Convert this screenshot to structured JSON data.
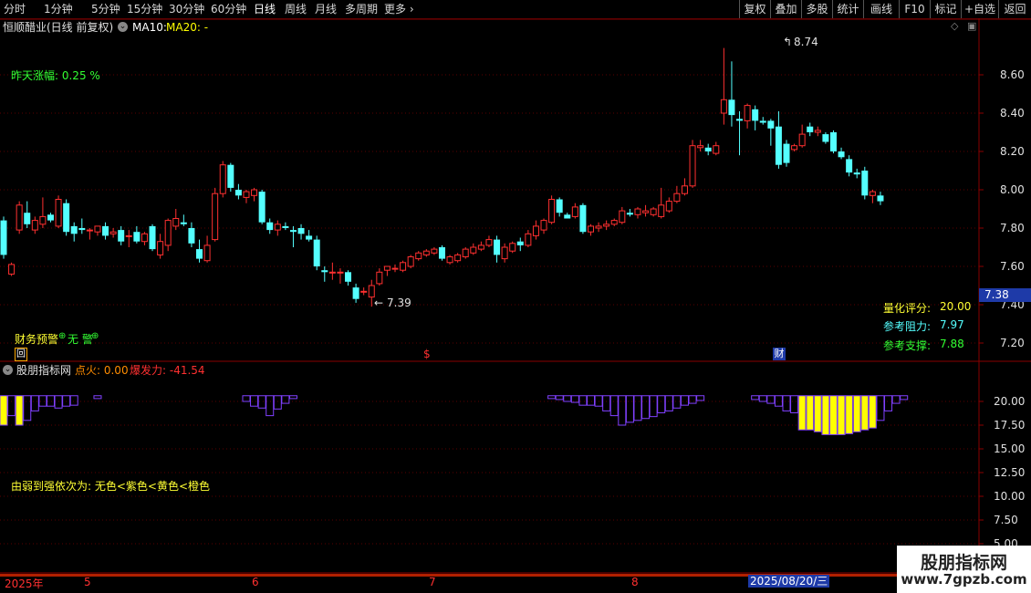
{
  "toolbar": {
    "periods": [
      "分时",
      "1分钟",
      "5分钟",
      "15分钟",
      "30分钟",
      "60分钟",
      "日线",
      "周线",
      "月线",
      "多周期",
      "更多"
    ],
    "active_period": "日线",
    "more_arrow": "›",
    "right_buttons": [
      "复权",
      "叠加",
      "多股",
      "统计",
      "画线",
      "F10",
      "标记",
      "+自选",
      "返回"
    ]
  },
  "main": {
    "stock_title": "恒顺醋业(日线 前复权)",
    "ma10_label": "MA10:",
    "ma20_label": "MA20: -",
    "yesterday_change": "昨天涨幅: 0.25 %",
    "high_label": "8.74",
    "low_label": "7.39",
    "current_price": "7.38",
    "score_label": "量化评分:",
    "score_value": "20.00",
    "resistance_label": "参考阻力:",
    "resistance_value": "7.97",
    "support_label": "参考支撑:",
    "support_value": "7.88",
    "warning_text": "财务预警",
    "no_warning_text": "无 警",
    "marker_hui": "回",
    "marker_dollar": "$",
    "marker_cai": "财",
    "price_axis": [
      "8.60",
      "8.40",
      "8.20",
      "8.00",
      "7.80",
      "7.60",
      "7.40",
      "7.20"
    ]
  },
  "sub": {
    "indicator_name": "股朋指标网",
    "ignite_label": "点火: 0.00",
    "burst_label": "爆发力: -41.54",
    "legend_text": "由弱到强依次为: 无色<紫色<黄色<橙色",
    "axis": [
      "20.00",
      "17.50",
      "15.00",
      "12.50",
      "10.00",
      "7.50",
      "5.00"
    ]
  },
  "timeline": {
    "labels": [
      "2025年",
      "5",
      "6",
      "7",
      "8"
    ],
    "date_box": "2025/08/20/三"
  },
  "watermark": {
    "line1": "股朋指标网",
    "line2": "www.7gpzb.com"
  },
  "colors": {
    "up": "#ff3030",
    "down": "#54ffff",
    "purple": "#8040ff",
    "yellow": "#ffff00",
    "grid": "#5a0000"
  },
  "chart_data": {
    "type": "candlestick",
    "price_ylim": [
      7.1,
      8.8
    ],
    "sub_ylim": [
      2.5,
      22.5
    ],
    "candles": [
      {
        "o": 7.84,
        "h": 7.86,
        "l": 7.64,
        "c": 7.66
      },
      {
        "o": 7.56,
        "h": 7.62,
        "l": 7.55,
        "c": 7.61
      },
      {
        "o": 7.79,
        "h": 7.94,
        "l": 7.77,
        "c": 7.92
      },
      {
        "o": 7.88,
        "h": 7.94,
        "l": 7.8,
        "c": 7.82
      },
      {
        "o": 7.79,
        "h": 7.86,
        "l": 7.77,
        "c": 7.84
      },
      {
        "o": 7.82,
        "h": 7.96,
        "l": 7.8,
        "c": 7.86
      },
      {
        "o": 7.87,
        "h": 7.88,
        "l": 7.83,
        "c": 7.84
      },
      {
        "o": 7.81,
        "h": 7.97,
        "l": 7.8,
        "c": 7.95
      },
      {
        "o": 7.93,
        "h": 7.95,
        "l": 7.76,
        "c": 7.78
      },
      {
        "o": 7.81,
        "h": 7.83,
        "l": 7.73,
        "c": 7.77
      },
      {
        "o": 7.8,
        "h": 7.85,
        "l": 7.77,
        "c": 7.79
      },
      {
        "o": 7.79,
        "h": 7.8,
        "l": 7.74,
        "c": 7.79
      },
      {
        "o": 7.78,
        "h": 7.81,
        "l": 7.76,
        "c": 7.81
      },
      {
        "o": 7.81,
        "h": 7.83,
        "l": 7.74,
        "c": 7.76
      },
      {
        "o": 7.77,
        "h": 7.8,
        "l": 7.75,
        "c": 7.78
      },
      {
        "o": 7.79,
        "h": 7.81,
        "l": 7.71,
        "c": 7.73
      },
      {
        "o": 7.76,
        "h": 7.79,
        "l": 7.7,
        "c": 7.76
      },
      {
        "o": 7.78,
        "h": 7.81,
        "l": 7.72,
        "c": 7.73
      },
      {
        "o": 7.73,
        "h": 7.78,
        "l": 7.71,
        "c": 7.77
      },
      {
        "o": 7.81,
        "h": 7.82,
        "l": 7.68,
        "c": 7.69
      },
      {
        "o": 7.66,
        "h": 7.77,
        "l": 7.64,
        "c": 7.73
      },
      {
        "o": 7.71,
        "h": 7.85,
        "l": 7.68,
        "c": 7.84
      },
      {
        "o": 7.81,
        "h": 7.9,
        "l": 7.79,
        "c": 7.85
      },
      {
        "o": 7.83,
        "h": 7.87,
        "l": 7.81,
        "c": 7.82
      },
      {
        "o": 7.8,
        "h": 7.83,
        "l": 7.7,
        "c": 7.72
      },
      {
        "o": 7.69,
        "h": 7.74,
        "l": 7.62,
        "c": 7.64
      },
      {
        "o": 7.63,
        "h": 7.76,
        "l": 7.62,
        "c": 7.71
      },
      {
        "o": 7.74,
        "h": 8.01,
        "l": 7.73,
        "c": 7.98
      },
      {
        "o": 7.98,
        "h": 8.15,
        "l": 7.96,
        "c": 8.13
      },
      {
        "o": 8.13,
        "h": 8.14,
        "l": 7.99,
        "c": 8.01
      },
      {
        "o": 8.0,
        "h": 8.03,
        "l": 7.95,
        "c": 7.97
      },
      {
        "o": 7.96,
        "h": 8.0,
        "l": 7.93,
        "c": 7.99
      },
      {
        "o": 7.97,
        "h": 8.01,
        "l": 7.94,
        "c": 8.0
      },
      {
        "o": 7.99,
        "h": 8.0,
        "l": 7.82,
        "c": 7.83
      },
      {
        "o": 7.83,
        "h": 7.85,
        "l": 7.77,
        "c": 7.79
      },
      {
        "o": 7.79,
        "h": 7.84,
        "l": 7.76,
        "c": 7.82
      },
      {
        "o": 7.81,
        "h": 7.83,
        "l": 7.79,
        "c": 7.8
      },
      {
        "o": 7.79,
        "h": 7.81,
        "l": 7.7,
        "c": 7.78
      },
      {
        "o": 7.8,
        "h": 7.82,
        "l": 7.74,
        "c": 7.77
      },
      {
        "o": 7.76,
        "h": 7.79,
        "l": 7.73,
        "c": 7.74
      },
      {
        "o": 7.74,
        "h": 7.76,
        "l": 7.58,
        "c": 7.6
      },
      {
        "o": 7.58,
        "h": 7.6,
        "l": 7.52,
        "c": 7.57
      },
      {
        "o": 7.57,
        "h": 7.62,
        "l": 7.53,
        "c": 7.57
      },
      {
        "o": 7.57,
        "h": 7.59,
        "l": 7.51,
        "c": 7.57
      },
      {
        "o": 7.57,
        "h": 7.58,
        "l": 7.5,
        "c": 7.52
      },
      {
        "o": 7.49,
        "h": 7.51,
        "l": 7.41,
        "c": 7.43
      },
      {
        "o": 7.47,
        "h": 7.49,
        "l": 7.45,
        "c": 7.47
      },
      {
        "o": 7.44,
        "h": 7.53,
        "l": 7.39,
        "c": 7.5
      },
      {
        "o": 7.51,
        "h": 7.59,
        "l": 7.5,
        "c": 7.57
      },
      {
        "o": 7.58,
        "h": 7.6,
        "l": 7.55,
        "c": 7.6
      },
      {
        "o": 7.59,
        "h": 7.61,
        "l": 7.57,
        "c": 7.59
      },
      {
        "o": 7.58,
        "h": 7.63,
        "l": 7.57,
        "c": 7.62
      },
      {
        "o": 7.6,
        "h": 7.66,
        "l": 7.59,
        "c": 7.65
      },
      {
        "o": 7.64,
        "h": 7.68,
        "l": 7.63,
        "c": 7.67
      },
      {
        "o": 7.66,
        "h": 7.69,
        "l": 7.65,
        "c": 7.68
      },
      {
        "o": 7.67,
        "h": 7.7,
        "l": 7.66,
        "c": 7.69
      },
      {
        "o": 7.7,
        "h": 7.71,
        "l": 7.63,
        "c": 7.64
      },
      {
        "o": 7.62,
        "h": 7.66,
        "l": 7.61,
        "c": 7.65
      },
      {
        "o": 7.63,
        "h": 7.67,
        "l": 7.62,
        "c": 7.66
      },
      {
        "o": 7.65,
        "h": 7.7,
        "l": 7.64,
        "c": 7.69
      },
      {
        "o": 7.67,
        "h": 7.72,
        "l": 7.66,
        "c": 7.7
      },
      {
        "o": 7.69,
        "h": 7.73,
        "l": 7.68,
        "c": 7.71
      },
      {
        "o": 7.71,
        "h": 7.76,
        "l": 7.7,
        "c": 7.74
      },
      {
        "o": 7.74,
        "h": 7.76,
        "l": 7.62,
        "c": 7.66
      },
      {
        "o": 7.64,
        "h": 7.72,
        "l": 7.62,
        "c": 7.7
      },
      {
        "o": 7.68,
        "h": 7.73,
        "l": 7.67,
        "c": 7.72
      },
      {
        "o": 7.73,
        "h": 7.75,
        "l": 7.68,
        "c": 7.71
      },
      {
        "o": 7.71,
        "h": 7.79,
        "l": 7.7,
        "c": 7.77
      },
      {
        "o": 7.76,
        "h": 7.84,
        "l": 7.74,
        "c": 7.81
      },
      {
        "o": 7.79,
        "h": 7.85,
        "l": 7.77,
        "c": 7.84
      },
      {
        "o": 7.83,
        "h": 7.97,
        "l": 7.82,
        "c": 7.95
      },
      {
        "o": 7.95,
        "h": 7.96,
        "l": 7.86,
        "c": 7.88
      },
      {
        "o": 7.87,
        "h": 7.88,
        "l": 7.85,
        "c": 7.85
      },
      {
        "o": 7.86,
        "h": 7.93,
        "l": 7.85,
        "c": 7.91
      },
      {
        "o": 7.92,
        "h": 7.93,
        "l": 7.77,
        "c": 7.78
      },
      {
        "o": 7.78,
        "h": 7.82,
        "l": 7.76,
        "c": 7.81
      },
      {
        "o": 7.8,
        "h": 7.83,
        "l": 7.78,
        "c": 7.81
      },
      {
        "o": 7.81,
        "h": 7.84,
        "l": 7.79,
        "c": 7.82
      },
      {
        "o": 7.82,
        "h": 7.85,
        "l": 7.81,
        "c": 7.84
      },
      {
        "o": 7.83,
        "h": 7.91,
        "l": 7.82,
        "c": 7.89
      },
      {
        "o": 7.88,
        "h": 7.9,
        "l": 7.86,
        "c": 7.87
      },
      {
        "o": 7.87,
        "h": 7.91,
        "l": 7.85,
        "c": 7.9
      },
      {
        "o": 7.88,
        "h": 7.92,
        "l": 7.86,
        "c": 7.89
      },
      {
        "o": 7.87,
        "h": 7.91,
        "l": 7.86,
        "c": 7.9
      },
      {
        "o": 7.86,
        "h": 8.01,
        "l": 7.85,
        "c": 7.92
      },
      {
        "o": 7.89,
        "h": 7.96,
        "l": 7.88,
        "c": 7.94
      },
      {
        "o": 7.94,
        "h": 8.02,
        "l": 7.93,
        "c": 7.98
      },
      {
        "o": 7.98,
        "h": 8.06,
        "l": 7.97,
        "c": 8.02
      },
      {
        "o": 8.02,
        "h": 8.26,
        "l": 8.01,
        "c": 8.23
      },
      {
        "o": 8.22,
        "h": 8.26,
        "l": 8.2,
        "c": 8.23
      },
      {
        "o": 8.22,
        "h": 8.24,
        "l": 8.18,
        "c": 8.2
      },
      {
        "o": 8.19,
        "h": 8.25,
        "l": 8.18,
        "c": 8.23
      },
      {
        "o": 8.4,
        "h": 8.74,
        "l": 8.34,
        "c": 8.47
      },
      {
        "o": 8.47,
        "h": 8.67,
        "l": 8.33,
        "c": 8.39
      },
      {
        "o": 8.37,
        "h": 8.41,
        "l": 8.18,
        "c": 8.36
      },
      {
        "o": 8.36,
        "h": 8.45,
        "l": 8.32,
        "c": 8.44
      },
      {
        "o": 8.42,
        "h": 8.44,
        "l": 8.31,
        "c": 8.36
      },
      {
        "o": 8.36,
        "h": 8.38,
        "l": 8.34,
        "c": 8.35
      },
      {
        "o": 8.36,
        "h": 8.37,
        "l": 8.23,
        "c": 8.32
      },
      {
        "o": 8.33,
        "h": 8.41,
        "l": 8.11,
        "c": 8.13
      },
      {
        "o": 8.24,
        "h": 8.26,
        "l": 8.12,
        "c": 8.14
      },
      {
        "o": 8.21,
        "h": 8.24,
        "l": 8.2,
        "c": 8.23
      },
      {
        "o": 8.23,
        "h": 8.34,
        "l": 8.22,
        "c": 8.29
      },
      {
        "o": 8.33,
        "h": 8.35,
        "l": 8.28,
        "c": 8.3
      },
      {
        "o": 8.3,
        "h": 8.33,
        "l": 8.28,
        "c": 8.31
      },
      {
        "o": 8.29,
        "h": 8.3,
        "l": 8.24,
        "c": 8.25
      },
      {
        "o": 8.3,
        "h": 8.31,
        "l": 8.19,
        "c": 8.2
      },
      {
        "o": 8.2,
        "h": 8.22,
        "l": 8.16,
        "c": 8.17
      },
      {
        "o": 8.16,
        "h": 8.18,
        "l": 8.07,
        "c": 8.09
      },
      {
        "o": 8.09,
        "h": 8.11,
        "l": 8.06,
        "c": 8.08
      },
      {
        "o": 8.1,
        "h": 8.12,
        "l": 7.95,
        "c": 7.97
      },
      {
        "o": 7.97,
        "h": 8.0,
        "l": 7.93,
        "c": 7.99
      },
      {
        "o": 7.97,
        "h": 7.99,
        "l": 7.92,
        "c": 7.94
      }
    ],
    "sub_bars": [
      {
        "i": 0,
        "c": "y",
        "v": 17.5
      },
      {
        "i": 1,
        "c": "p",
        "v": 18.5
      },
      {
        "i": 2,
        "c": "y",
        "v": 17.5
      },
      {
        "i": 3,
        "c": "p",
        "v": 18.0
      },
      {
        "i": 4,
        "c": "p",
        "v": 19.0
      },
      {
        "i": 5,
        "c": "p",
        "v": 19.5
      },
      {
        "i": 6,
        "c": "p",
        "v": 19.5
      },
      {
        "i": 7,
        "c": "p",
        "v": 19.3
      },
      {
        "i": 8,
        "c": "p",
        "v": 19.5
      },
      {
        "i": 9,
        "c": "p",
        "v": 19.6
      },
      {
        "i": 12,
        "c": "p",
        "v": 20.3
      },
      {
        "i": 31,
        "c": "p",
        "v": 20.0
      },
      {
        "i": 32,
        "c": "p",
        "v": 19.5
      },
      {
        "i": 33,
        "c": "p",
        "v": 19.3
      },
      {
        "i": 34,
        "c": "p",
        "v": 18.5
      },
      {
        "i": 35,
        "c": "p",
        "v": 19.2
      },
      {
        "i": 36,
        "c": "p",
        "v": 19.8
      },
      {
        "i": 37,
        "c": "p",
        "v": 20.3
      },
      {
        "i": 70,
        "c": "p",
        "v": 20.3
      },
      {
        "i": 71,
        "c": "p",
        "v": 20.2
      },
      {
        "i": 72,
        "c": "p",
        "v": 20.0
      },
      {
        "i": 73,
        "c": "p",
        "v": 19.9
      },
      {
        "i": 74,
        "c": "p",
        "v": 19.6
      },
      {
        "i": 75,
        "c": "p",
        "v": 19.6
      },
      {
        "i": 76,
        "c": "p",
        "v": 19.5
      },
      {
        "i": 77,
        "c": "p",
        "v": 19.0
      },
      {
        "i": 78,
        "c": "p",
        "v": 18.5
      },
      {
        "i": 79,
        "c": "p",
        "v": 17.5
      },
      {
        "i": 80,
        "c": "p",
        "v": 17.8
      },
      {
        "i": 81,
        "c": "p",
        "v": 18.0
      },
      {
        "i": 82,
        "c": "p",
        "v": 18.2
      },
      {
        "i": 83,
        "c": "p",
        "v": 18.4
      },
      {
        "i": 84,
        "c": "p",
        "v": 18.8
      },
      {
        "i": 85,
        "c": "p",
        "v": 19.0
      },
      {
        "i": 86,
        "c": "p",
        "v": 19.3
      },
      {
        "i": 87,
        "c": "p",
        "v": 19.6
      },
      {
        "i": 88,
        "c": "p",
        "v": 19.8
      },
      {
        "i": 89,
        "c": "p",
        "v": 20.1
      },
      {
        "i": 96,
        "c": "p",
        "v": 20.2
      },
      {
        "i": 97,
        "c": "p",
        "v": 20.0
      },
      {
        "i": 98,
        "c": "p",
        "v": 19.8
      },
      {
        "i": 99,
        "c": "p",
        "v": 19.5
      },
      {
        "i": 100,
        "c": "p",
        "v": 19.0
      },
      {
        "i": 101,
        "c": "p",
        "v": 18.8
      },
      {
        "i": 102,
        "c": "y",
        "v": 17.0
      },
      {
        "i": 103,
        "c": "y",
        "v": 17.0
      },
      {
        "i": 104,
        "c": "y",
        "v": 16.8
      },
      {
        "i": 105,
        "c": "y",
        "v": 16.5
      },
      {
        "i": 106,
        "c": "y",
        "v": 16.5
      },
      {
        "i": 107,
        "c": "y",
        "v": 16.5
      },
      {
        "i": 108,
        "c": "y",
        "v": 16.6
      },
      {
        "i": 109,
        "c": "y",
        "v": 16.8
      },
      {
        "i": 110,
        "c": "y",
        "v": 17.0
      },
      {
        "i": 111,
        "c": "y",
        "v": 17.2
      },
      {
        "i": 112,
        "c": "p",
        "v": 18.0
      },
      {
        "i": 113,
        "c": "p",
        "v": 19.0
      },
      {
        "i": 114,
        "c": "p",
        "v": 19.8
      },
      {
        "i": 115,
        "c": "p",
        "v": 20.2
      }
    ]
  }
}
